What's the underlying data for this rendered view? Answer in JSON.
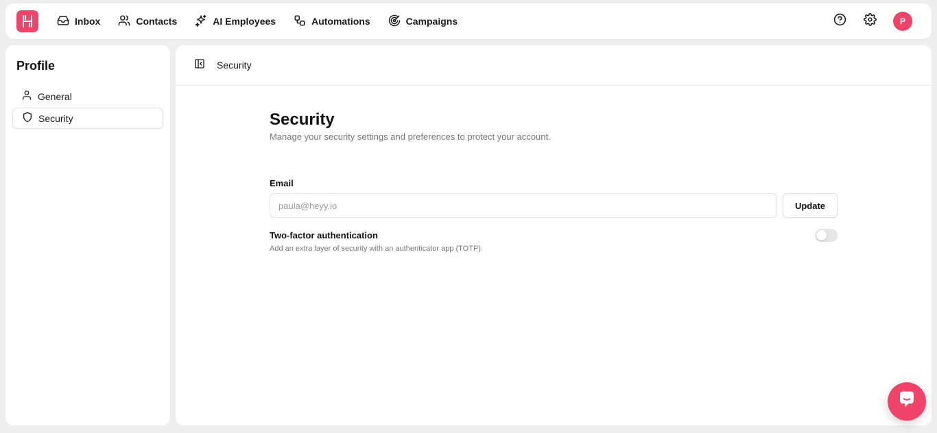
{
  "brand": {
    "logo_icon": "heyy-logo-icon",
    "accent": "#f0436a"
  },
  "nav": {
    "items": [
      {
        "label": "Inbox",
        "icon": "inbox-icon"
      },
      {
        "label": "Contacts",
        "icon": "users-icon"
      },
      {
        "label": "AI Employees",
        "icon": "sparkles-icon"
      },
      {
        "label": "Automations",
        "icon": "workflow-icon"
      },
      {
        "label": "Campaigns",
        "icon": "target-icon"
      }
    ]
  },
  "header_right": {
    "help_icon": "help-circle-icon",
    "settings_icon": "gear-icon",
    "avatar_initial": "P"
  },
  "sidebar": {
    "title": "Profile",
    "items": [
      {
        "label": "General",
        "icon": "user-icon",
        "active": false
      },
      {
        "label": "Security",
        "icon": "shield-icon",
        "active": true
      }
    ]
  },
  "main": {
    "breadcrumb": "Security",
    "title": "Security",
    "subtitle": "Manage your security settings and preferences to protect your account.",
    "email": {
      "label": "Email",
      "placeholder": "paula@heyy.io",
      "update_label": "Update"
    },
    "two_factor": {
      "title": "Two-factor authentication",
      "description": "Add an extra layer of security with an authenticator app (TOTP).",
      "enabled": false
    }
  },
  "chat_widget": {
    "icon": "chat-bubble-icon"
  }
}
